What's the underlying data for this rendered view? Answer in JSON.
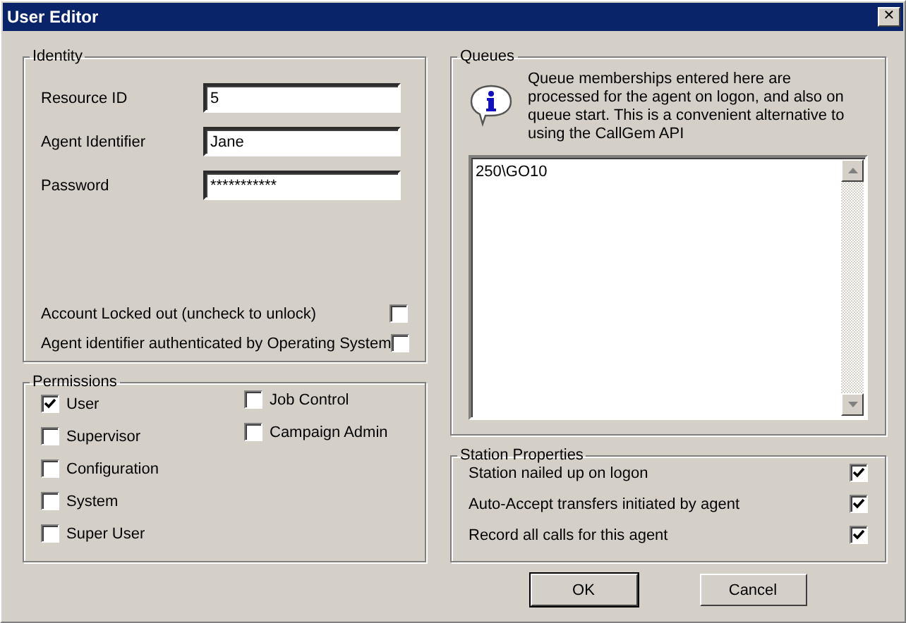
{
  "window": {
    "title": "User Editor",
    "close": "✕"
  },
  "identity": {
    "title": "Identity",
    "fields": [
      {
        "label": "Resource ID",
        "value": "5"
      },
      {
        "label": "Agent Identifier",
        "value": "Jane"
      },
      {
        "label": "Password",
        "value": "***********"
      }
    ],
    "options": [
      {
        "label": "Account Locked out (uncheck to unlock)",
        "checked": false
      },
      {
        "label": "Agent identifier authenticated by Operating System",
        "checked": false
      }
    ]
  },
  "permissions": {
    "title": "Permissions",
    "columns": [
      [
        {
          "label": "User",
          "checked": true
        },
        {
          "label": "Supervisor",
          "checked": false
        },
        {
          "label": "Configuration",
          "checked": false
        },
        {
          "label": "System",
          "checked": false
        },
        {
          "label": "Super User",
          "checked": false
        }
      ],
      [
        {
          "label": "Job Control",
          "checked": false
        },
        {
          "label": "Campaign Admin",
          "checked": false
        }
      ]
    ]
  },
  "queues": {
    "title": "Queues",
    "info": "Queue memberships entered here are processed for the agent on logon, and also on queue start. This is a convenient alternative to using the CallGem API",
    "value": "250\\GO10"
  },
  "station_properties": {
    "title": "Station Properties",
    "options": [
      {
        "label": "Station nailed up on logon",
        "checked": true
      },
      {
        "label": "Auto-Accept transfers initiated by agent",
        "checked": true
      },
      {
        "label": "Record all calls for this agent",
        "checked": true
      }
    ]
  },
  "buttons": [
    {
      "label": "OK",
      "default": true
    },
    {
      "label": "Cancel",
      "default": false
    }
  ]
}
